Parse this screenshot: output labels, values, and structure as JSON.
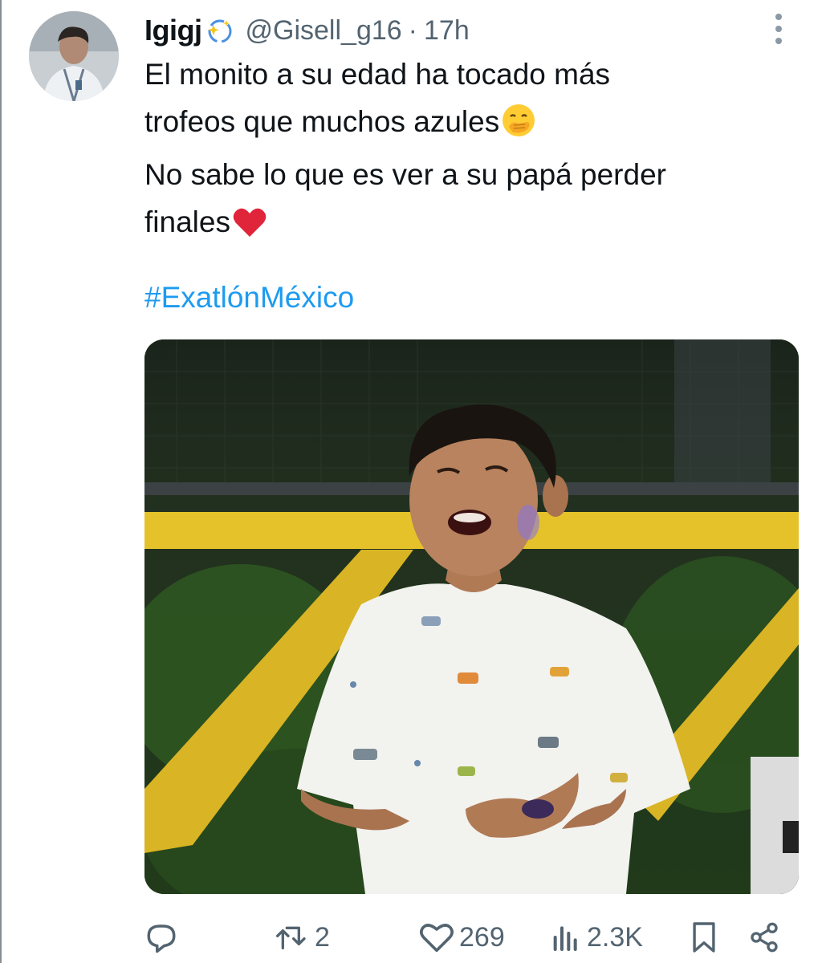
{
  "tweet": {
    "author_name": "Igigj",
    "handle": "@Gisell_g16",
    "separator": "·",
    "time": "17h",
    "text_lines": [
      "El monito a su edad ha tocado más",
      "trofeos que muchos azules",
      "No sabe lo que es ver a su papá perder",
      "finales"
    ],
    "emojis": [
      "hand-over-mouth-emoji",
      "red-heart-emoji"
    ],
    "hashtag": "#ExatlónMéxico",
    "media_description_icon": "video-thumbnail"
  },
  "actions": {
    "reply_count": "",
    "retweet_count": "2",
    "like_count": "269",
    "views_count": "2.3K"
  },
  "icons": {
    "reply": "reply-icon",
    "retweet": "retweet-icon",
    "like": "heart-icon",
    "views": "views-icon",
    "bookmark": "bookmark-icon",
    "share": "share-icon",
    "more": "more-options-icon"
  },
  "colors": {
    "text": "#0f1419",
    "secondary": "#536471",
    "link": "#1d9bf0",
    "heart": "#e0245e"
  }
}
